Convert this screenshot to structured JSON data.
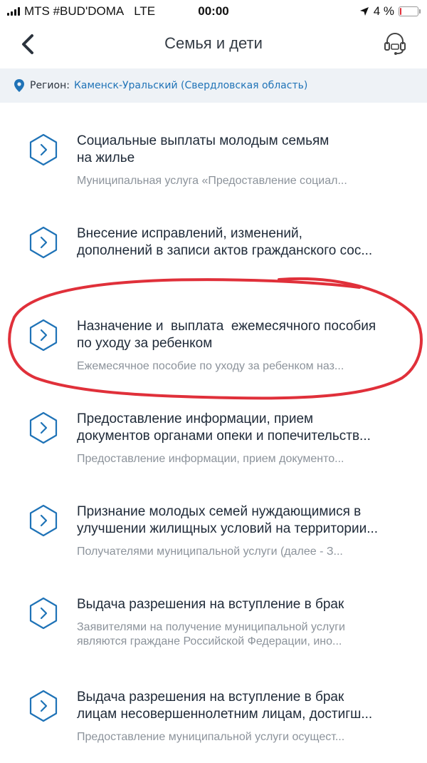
{
  "status_bar": {
    "carrier": "MTS #BUD'DOMA",
    "network": "LTE",
    "time": "00:00",
    "battery_percent": "4 %",
    "battery_level": 0.04,
    "icons": [
      "signal-icon",
      "location-arrow-icon",
      "battery-icon"
    ]
  },
  "nav": {
    "title": "Семья и дети",
    "back_icon": "chevron-left-icon",
    "support_icon": "headset-icon"
  },
  "region": {
    "label": "Регион:",
    "value": "Каменск-Уральский (Свердловская область)"
  },
  "colors": {
    "accent": "#1f73b7",
    "region_bg": "#eef2f6",
    "annotation": "#e0303a",
    "muted_text": "#8c939b"
  },
  "services": [
    {
      "title_lines": [
        "Социальные выплаты молодым семьям",
        "на жилье"
      ],
      "desc_lines": [
        "Муниципальная услуга «Предоставление социал..."
      ]
    },
    {
      "title_lines": [
        "Внесение исправлений, изменений,",
        "дополнений в записи актов гражданского сос..."
      ],
      "desc_lines": []
    },
    {
      "title_lines": [
        "Назначение и  выплата  ежемесячного пособия",
        "по уходу за ребенком"
      ],
      "desc_lines": [
        "Ежемесячное пособие по уходу за ребенком наз..."
      ]
    },
    {
      "title_lines": [
        "Предоставление информации, прием",
        "документов органами опеки и попечительств..."
      ],
      "desc_lines": [
        "Предоставление информации, прием документо..."
      ]
    },
    {
      "title_lines": [
        "Признание молодых семей нуждающимися в",
        "улучшении жилищных условий на территории..."
      ],
      "desc_lines": [
        "Получателями муниципальной услуги (далее - З..."
      ]
    },
    {
      "title_lines": [
        "Выдача разрешения на вступление в брак"
      ],
      "desc_lines": [
        "Заявителями на получение муниципальной услуги",
        "являются граждане Российской Федерации, ино..."
      ]
    },
    {
      "title_lines": [
        "Выдача разрешения на вступление в брак",
        "лицам несовершеннолетним лицам, достигш..."
      ],
      "desc_lines": [
        "Предоставление муниципальной услуги осущест..."
      ]
    }
  ]
}
